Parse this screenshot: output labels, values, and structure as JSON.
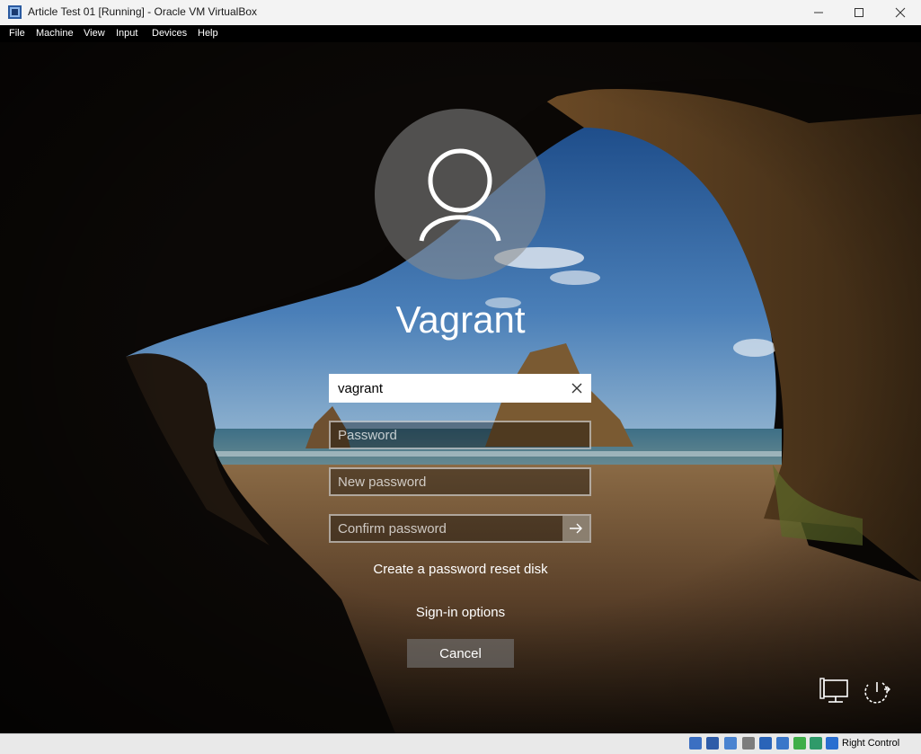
{
  "window": {
    "title": "Article Test 01 [Running] - Oracle VM VirtualBox",
    "icon": "virtualbox-icon",
    "controls": [
      "minimize-icon",
      "maximize-icon",
      "close-icon"
    ]
  },
  "menu": [
    "File",
    "Machine",
    "View",
    "Input",
    "Devices",
    "Help"
  ],
  "login": {
    "user_display_name": "Vagrant",
    "username_value": "vagrant",
    "password_placeholder": "Password",
    "new_password_placeholder": "New password",
    "confirm_password_placeholder": "Confirm password",
    "reset_disk_link": "Create a password reset disk",
    "signin_options_link": "Sign-in options",
    "cancel_label": "Cancel",
    "icons": [
      "user-avatar-icon",
      "clear-icon",
      "arrow-right-icon",
      "network-icon",
      "power-icon"
    ]
  },
  "statusbar": {
    "host_key_label": "Right Control",
    "icons": [
      "hard-disk-icon",
      "optical-drive-icon",
      "audio-icon",
      "network-adapter-icon",
      "usb-icon",
      "shared-folders-icon",
      "display-icon",
      "recording-icon",
      "cpu-icon",
      "mouse-integration-icon",
      "keyboard-icon"
    ]
  },
  "colors": {
    "titlebar_bg": "#f3f3f3",
    "menubar_bg": "#000000",
    "statusbar_bg": "#e9e9e9",
    "login_text": "#ffffff"
  }
}
